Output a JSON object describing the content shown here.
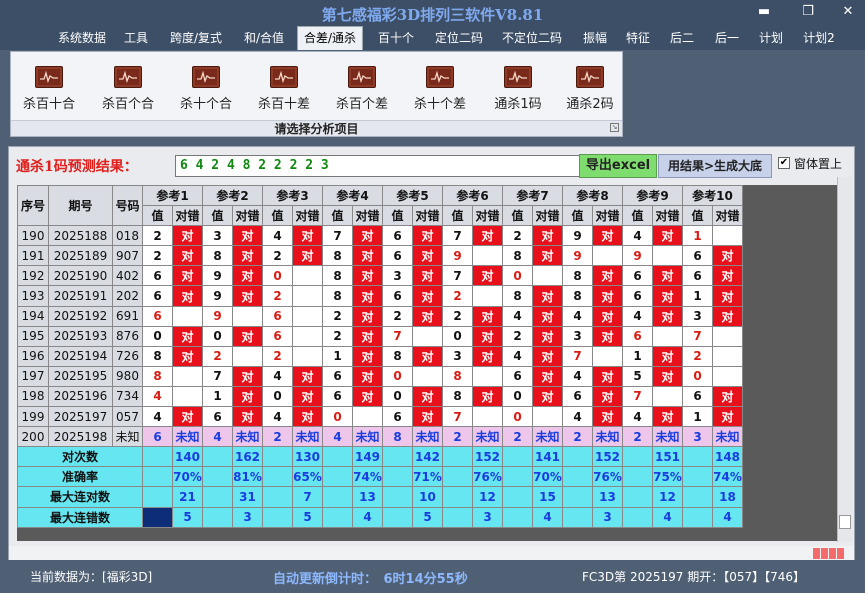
{
  "window": {
    "title": "第七感福彩3D排列三软件V8.81",
    "min": "▬",
    "restore": "❐",
    "close": "✕"
  },
  "menu": [
    "系统数据",
    "工具",
    "跨度/复式",
    "和/合值",
    "合差/通杀",
    "百十个",
    "定位二码",
    "不定位二码",
    "振幅",
    "特征",
    "后二",
    "后一",
    "计划",
    "计划2"
  ],
  "ribbon": {
    "items": [
      "杀百十合",
      "杀百个合",
      "杀十个合",
      "杀百十差",
      "杀百个差",
      "杀十个差",
      "通杀1码",
      "通杀2码"
    ],
    "footer": "请选择分析项目"
  },
  "prediction": {
    "label": "通杀1码预测结果：",
    "value": "6 4 2 4 8 2 2 2 2 3",
    "export": "导出excel",
    "generate": "用结果>生成大底",
    "topmost": "窗体置上",
    "check": "✔"
  },
  "table": {
    "headers": {
      "seq": "序号",
      "issue": "期号",
      "code": "号码",
      "val": "值",
      "chk": "对错",
      "refs": [
        "参考1",
        "参考2",
        "参考3",
        "参考4",
        "参考5",
        "参考6",
        "参考7",
        "参考8",
        "参考9",
        "参考10"
      ]
    },
    "hit": "对",
    "unknown": "未知",
    "rows": [
      {
        "seq": "190",
        "issue": "2025188",
        "code": "018",
        "v": [
          "2",
          "3",
          "4",
          "7",
          "6",
          "7",
          "2",
          "9",
          "4",
          "1"
        ],
        "h": [
          1,
          1,
          1,
          1,
          1,
          1,
          1,
          1,
          1,
          0
        ]
      },
      {
        "seq": "191",
        "issue": "2025189",
        "code": "907",
        "v": [
          "2",
          "8",
          "2",
          "8",
          "6",
          "9",
          "8",
          "9",
          "9",
          "6"
        ],
        "h": [
          1,
          1,
          1,
          1,
          1,
          0,
          1,
          0,
          0,
          1
        ]
      },
      {
        "seq": "192",
        "issue": "2025190",
        "code": "402",
        "v": [
          "6",
          "9",
          "0",
          "8",
          "3",
          "7",
          "0",
          "8",
          "6",
          "6"
        ],
        "h": [
          1,
          1,
          0,
          1,
          1,
          1,
          0,
          1,
          1,
          1
        ]
      },
      {
        "seq": "193",
        "issue": "2025191",
        "code": "202",
        "v": [
          "6",
          "9",
          "2",
          "8",
          "6",
          "2",
          "8",
          "8",
          "6",
          "1"
        ],
        "h": [
          1,
          1,
          0,
          1,
          1,
          0,
          1,
          1,
          1,
          1
        ]
      },
      {
        "seq": "194",
        "issue": "2025192",
        "code": "691",
        "v": [
          "6",
          "9",
          "6",
          "2",
          "2",
          "2",
          "4",
          "4",
          "4",
          "3"
        ],
        "h": [
          0,
          0,
          0,
          1,
          1,
          1,
          1,
          1,
          1,
          1
        ]
      },
      {
        "seq": "195",
        "issue": "2025193",
        "code": "876",
        "v": [
          "0",
          "0",
          "6",
          "2",
          "7",
          "0",
          "2",
          "3",
          "6",
          "7"
        ],
        "h": [
          1,
          1,
          0,
          1,
          0,
          1,
          1,
          1,
          0,
          0
        ]
      },
      {
        "seq": "196",
        "issue": "2025194",
        "code": "726",
        "v": [
          "8",
          "2",
          "2",
          "1",
          "8",
          "3",
          "4",
          "7",
          "1",
          "2"
        ],
        "h": [
          1,
          0,
          0,
          1,
          1,
          1,
          1,
          0,
          1,
          0
        ]
      },
      {
        "seq": "197",
        "issue": "2025195",
        "code": "980",
        "v": [
          "8",
          "7",
          "4",
          "6",
          "0",
          "8",
          "6",
          "4",
          "5",
          "0"
        ],
        "h": [
          0,
          1,
          1,
          1,
          0,
          0,
          1,
          1,
          1,
          0
        ]
      },
      {
        "seq": "198",
        "issue": "2025196",
        "code": "734",
        "v": [
          "4",
          "1",
          "0",
          "6",
          "0",
          "8",
          "0",
          "6",
          "7",
          "6"
        ],
        "h": [
          0,
          1,
          1,
          1,
          1,
          1,
          1,
          1,
          0,
          1
        ]
      },
      {
        "seq": "199",
        "issue": "2025197",
        "code": "057",
        "v": [
          "4",
          "6",
          "4",
          "0",
          "6",
          "7",
          "0",
          "4",
          "4",
          "1"
        ],
        "h": [
          1,
          1,
          1,
          0,
          1,
          0,
          0,
          1,
          1,
          1
        ]
      }
    ],
    "last": {
      "seq": "200",
      "issue": "2025198",
      "code": "未知",
      "v": [
        "6",
        "4",
        "2",
        "4",
        "8",
        "2",
        "2",
        "2",
        "2",
        "3"
      ]
    },
    "summary": [
      {
        "label": "对次数",
        "v": [
          "140",
          "162",
          "130",
          "149",
          "142",
          "152",
          "141",
          "152",
          "151",
          "148"
        ]
      },
      {
        "label": "准确率",
        "v": [
          "70%",
          "81%",
          "65%",
          "74%",
          "71%",
          "76%",
          "70%",
          "76%",
          "75%",
          "74%"
        ]
      },
      {
        "label": "最大连对数",
        "v": [
          "21",
          "31",
          "7",
          "13",
          "10",
          "12",
          "15",
          "13",
          "12",
          "18"
        ]
      },
      {
        "label": "最大连错数",
        "v": [
          "5",
          "3",
          "5",
          "4",
          "5",
          "3",
          "4",
          "3",
          "4",
          "4"
        ]
      }
    ]
  },
  "status": {
    "current": "当前数据为：[福彩3D]",
    "countdown": "自动更新倒计时：　6时14分55秒",
    "draw": "FC3D第 2025197 期开：【057】【746】"
  }
}
